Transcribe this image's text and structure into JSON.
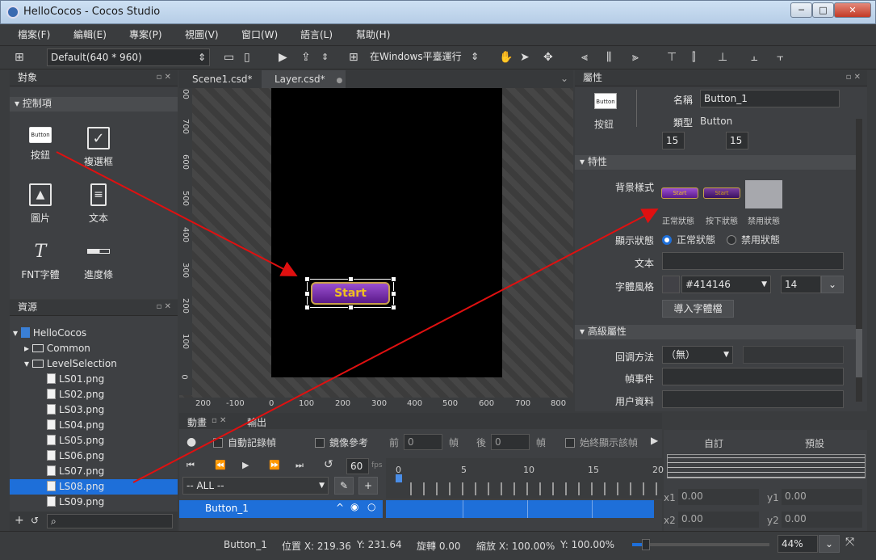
{
  "window": {
    "title": "HelloCocos - Cocos Studio",
    "min": "─",
    "max": "□",
    "close": "✕"
  },
  "menu": [
    "檔案(F)",
    "編輯(E)",
    "專案(P)",
    "視圖(V)",
    "窗口(W)",
    "語言(L)",
    "幫助(H)"
  ],
  "toolbar": {
    "resolution": "Default(640 * 960)",
    "run_target": "在Windows平臺運行"
  },
  "objects_panel": {
    "title": "對象",
    "section": "控制項",
    "controls": [
      {
        "label": "按鈕",
        "icon": "button-icon",
        "text": "Button"
      },
      {
        "label": "複選框",
        "icon": "checkbox-icon"
      },
      {
        "label": "圖片",
        "icon": "image-icon"
      },
      {
        "label": "文本",
        "icon": "text-icon"
      },
      {
        "label": "FNT字體",
        "icon": "fnt-font-icon",
        "glyph": "T"
      },
      {
        "label": "進度條",
        "icon": "progress-bar-icon"
      }
    ]
  },
  "resources_panel": {
    "title": "資源",
    "root": "HelloCocos",
    "items": [
      "Common",
      "LevelSelection",
      "LS01.png",
      "LS02.png",
      "LS03.png",
      "LS04.png",
      "LS05.png",
      "LS06.png",
      "LS07.png",
      "LS08.png",
      "LS09.png"
    ],
    "selected": "LS08.png"
  },
  "editor": {
    "tabs": [
      "Scene1.csd*",
      "Layer.csd*"
    ],
    "active_tab": "Layer.csd*",
    "button_text": "Start",
    "ruler_x": [
      "200",
      "-100",
      "0",
      "100",
      "200",
      "300",
      "400",
      "500",
      "600",
      "700",
      "800"
    ],
    "ruler_y": [
      "00",
      "700",
      "600",
      "500",
      "400",
      "300",
      "200",
      "100",
      "0"
    ]
  },
  "animation": {
    "tab": "動畫",
    "output_tab": "輸出",
    "auto_record": "自動記錄幀",
    "mirror": "鏡像參考",
    "prev": "前",
    "prev_val": "0",
    "frame": "幀",
    "next": "後",
    "next_val": "0",
    "always_show": "始終顯示該幀",
    "fps": "60",
    "fps_unit": "fps",
    "filter": "-- ALL --",
    "node": "Button_1",
    "ticks": [
      "0",
      "5",
      "10",
      "15",
      "20"
    ],
    "custom": "自訂",
    "preset": "預設",
    "x1": "x1",
    "x1_val": "0.00",
    "y1": "y1",
    "y1_val": "0.00",
    "x2": "x2",
    "x2_val": "0.00",
    "y2": "y2",
    "y2_val": "0.00"
  },
  "properties": {
    "title": "屬性",
    "type_label": "按鈕",
    "icon_text": "Button",
    "name_label": "名稱",
    "name": "Button_1",
    "class_label": "類型",
    "class": "Button",
    "w": "15",
    "h": "15",
    "section1": "特性",
    "bg_style": "背景樣式",
    "sprite_text": "Start",
    "states": [
      "正常狀態",
      "按下狀態",
      "禁用狀態"
    ],
    "display_state": "顯示狀態",
    "normal": "正常狀態",
    "disabled": "禁用狀態",
    "text_label": "文本",
    "font_style": "字體風格",
    "color": "#414146",
    "size": "14",
    "import_font": "導入字體檔",
    "section2": "高級屬性",
    "callback": "回调方法",
    "callback_val": "（無）",
    "frame_event": "幀事件",
    "user_data": "用户資料"
  },
  "status": {
    "node": "Button_1",
    "pos": "位置 X: 219.36",
    "posy": "Y: 231.64",
    "rot": "旋轉 0.00",
    "scale": "縮放 X: 100.00%",
    "scaley": "Y: 100.00%",
    "zoom": "44%"
  },
  "colors": {
    "arrow": "#e01010",
    "selection": "#1e6fd9",
    "accent_purple": "#7a2fb0",
    "gold": "#e6b800"
  }
}
